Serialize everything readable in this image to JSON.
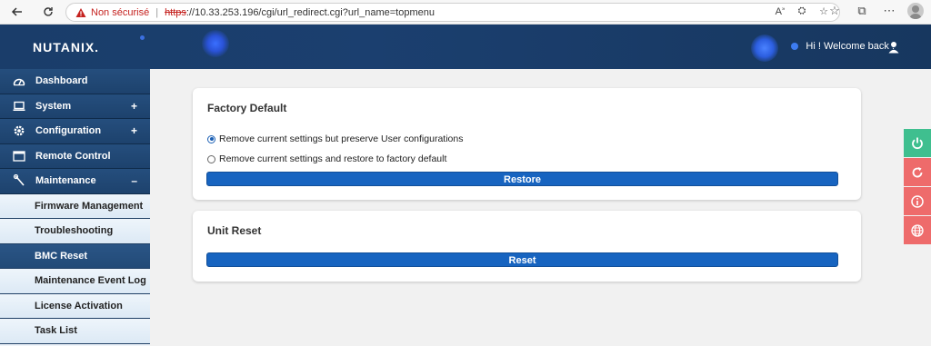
{
  "browser": {
    "insecure_label": "Non sécurisé",
    "url_scheme": "https",
    "url_rest": "://10.33.253.196/cgi/url_redirect.cgi?url_name=topmenu"
  },
  "header": {
    "logo": "NUTANIX.",
    "welcome": "Hi ! Welcome back !"
  },
  "sidebar": {
    "top_items": [
      {
        "label": "Dashboard",
        "icon": "dashboard-icon",
        "toggle": ""
      },
      {
        "label": "System",
        "icon": "laptop-icon",
        "toggle": "+"
      },
      {
        "label": "Configuration",
        "icon": "gear-icon",
        "toggle": "+"
      },
      {
        "label": "Remote Control",
        "icon": "monitor-icon",
        "toggle": ""
      },
      {
        "label": "Maintenance",
        "icon": "wrench-icon",
        "toggle": "–"
      }
    ],
    "sub_items": [
      {
        "label": "Firmware Management"
      },
      {
        "label": "Troubleshooting"
      },
      {
        "label": "BMC Reset"
      },
      {
        "label": "Maintenance Event Log"
      },
      {
        "label": "License Activation"
      },
      {
        "label": "Task List"
      }
    ]
  },
  "factory_default": {
    "title": "Factory Default",
    "option1": "Remove current settings but preserve User configurations",
    "option2": "Remove current settings and restore to factory default",
    "selected": "option1",
    "button": "Restore"
  },
  "unit_reset": {
    "title": "Unit Reset",
    "button": "Reset"
  },
  "colors": {
    "primary_button": "#1764c0",
    "header_bg": "#1a3d6a",
    "power_button": "#3fbf8f",
    "alert_buttons": "#ee6b6b"
  }
}
